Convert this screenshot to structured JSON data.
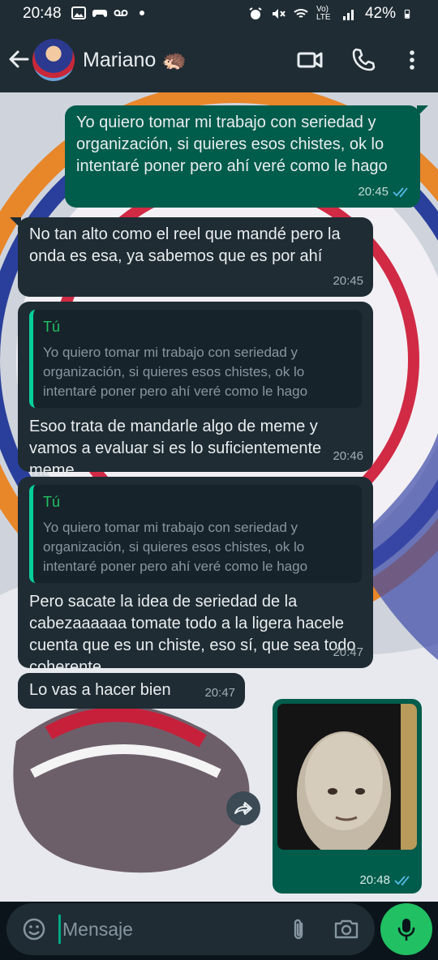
{
  "status_bar": {
    "time": "20:48",
    "battery": "42%",
    "network": "Vo) LTE"
  },
  "header": {
    "contact_name": "Mariano 🦔"
  },
  "messages": [
    {
      "direction": "out",
      "text": "Yo quiero tomar mi trabajo con seriedad y organización, si quieres esos chistes, ok lo intentaré poner pero ahí veré como le hago",
      "time": "20:45",
      "status": "read"
    },
    {
      "direction": "in",
      "text": "No tan alto como el reel que mandé pero la onda es esa, ya sabemos que es por ahí",
      "time": "20:45"
    },
    {
      "direction": "in",
      "quote_author": "Tú",
      "quote_text": "Yo quiero tomar mi trabajo con seriedad y organización, si quieres esos chistes, ok lo intentaré poner pero ahí veré como le hago",
      "text": "Esoo trata de mandarle algo de meme y vamos a evaluar si es lo suficientemente meme",
      "time": "20:46"
    },
    {
      "direction": "in",
      "quote_author": "Tú",
      "quote_text": "Yo quiero tomar mi trabajo con seriedad y organización, si quieres esos chistes, ok lo intentaré poner pero ahí veré como le hago",
      "text": "Pero sacate la idea de seriedad de la cabezaaaaaa tomate todo a la ligera hacele cuenta que es un chiste, eso sí, que sea todo coherente",
      "time": "20:47"
    },
    {
      "direction": "in",
      "text": "Lo vas a hacer bien",
      "time": "20:47"
    },
    {
      "direction": "out",
      "type": "image",
      "time": "20:48",
      "status": "read"
    }
  ],
  "input": {
    "placeholder": "Mensaje"
  },
  "colors": {
    "header_bg": "#1f2c34",
    "outgoing_bubble": "#005c4b",
    "incoming_bubble": "#1f2c34",
    "accent_green": "#21c063",
    "read_ticks": "#53bdeb"
  }
}
